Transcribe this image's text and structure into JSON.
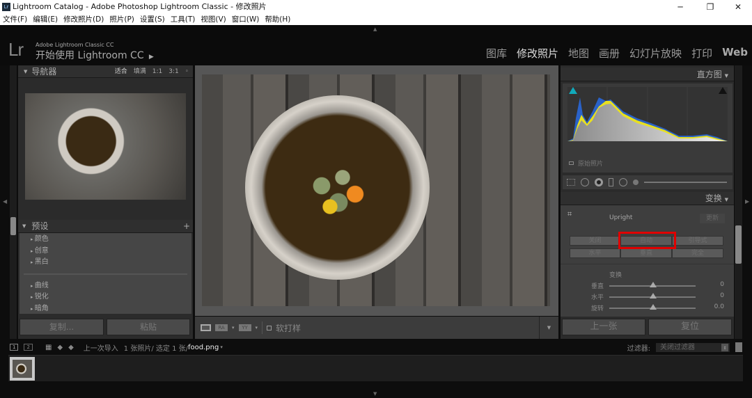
{
  "window": {
    "title": "Lightroom Catalog - Adobe Photoshop Lightroom Classic - 修改照片",
    "minimize": "─",
    "maximize": "❐",
    "close": "✕"
  },
  "menu": [
    "文件(F)",
    "编辑(E)",
    "修改照片(D)",
    "照片(P)",
    "设置(S)",
    "工具(T)",
    "视图(V)",
    "窗口(W)",
    "帮助(H)"
  ],
  "header": {
    "logo": "Lr",
    "product": "Adobe Lightroom Classic CC",
    "identity": "开始使用 Lightroom CC",
    "modules": [
      "图库",
      "修改照片",
      "地图",
      "画册",
      "幻灯片放映",
      "打印",
      "Web"
    ],
    "active_module": "修改照片"
  },
  "navigator": {
    "title": "导航器",
    "zoom_options": [
      "适合",
      "填满",
      "1:1",
      "3:1"
    ],
    "active_zoom": "适合"
  },
  "presets": {
    "title": "预设",
    "add": "+",
    "groups_a": [
      "颜色",
      "创意",
      "黑白"
    ],
    "groups_b": [
      "曲线",
      "锐化",
      "暗角"
    ]
  },
  "left_buttons": {
    "copy": "复制...",
    "paste": "粘贴"
  },
  "toolbar": {
    "soft_proof": "软打样"
  },
  "histogram": {
    "title": "直方图",
    "original_photo": "原始照片"
  },
  "transform": {
    "title": "变换",
    "upright_label": "Upright",
    "update": "更新",
    "upright_buttons": [
      "关闭",
      "自动",
      "引导式",
      "水平",
      "垂直",
      "完全"
    ],
    "highlighted": "自动",
    "section": "变换",
    "sliders": [
      {
        "label": "垂直",
        "value": "0"
      },
      {
        "label": "水平",
        "value": "0"
      },
      {
        "label": "旋转",
        "value": "0.0"
      }
    ]
  },
  "right_buttons": {
    "previous": "上一张",
    "reset": "复位"
  },
  "filmstrip": {
    "view1": "1",
    "view2": "2",
    "source": "上一次导入",
    "count": "1 张照片/ 选定 1 张/",
    "filename": "food.png",
    "filter_label": "过滤器:",
    "filter_value": "关闭过滤器"
  },
  "colors": {
    "highlight": "#e00000",
    "background": "#0d0d0d",
    "panel": "#2b2b2b"
  }
}
